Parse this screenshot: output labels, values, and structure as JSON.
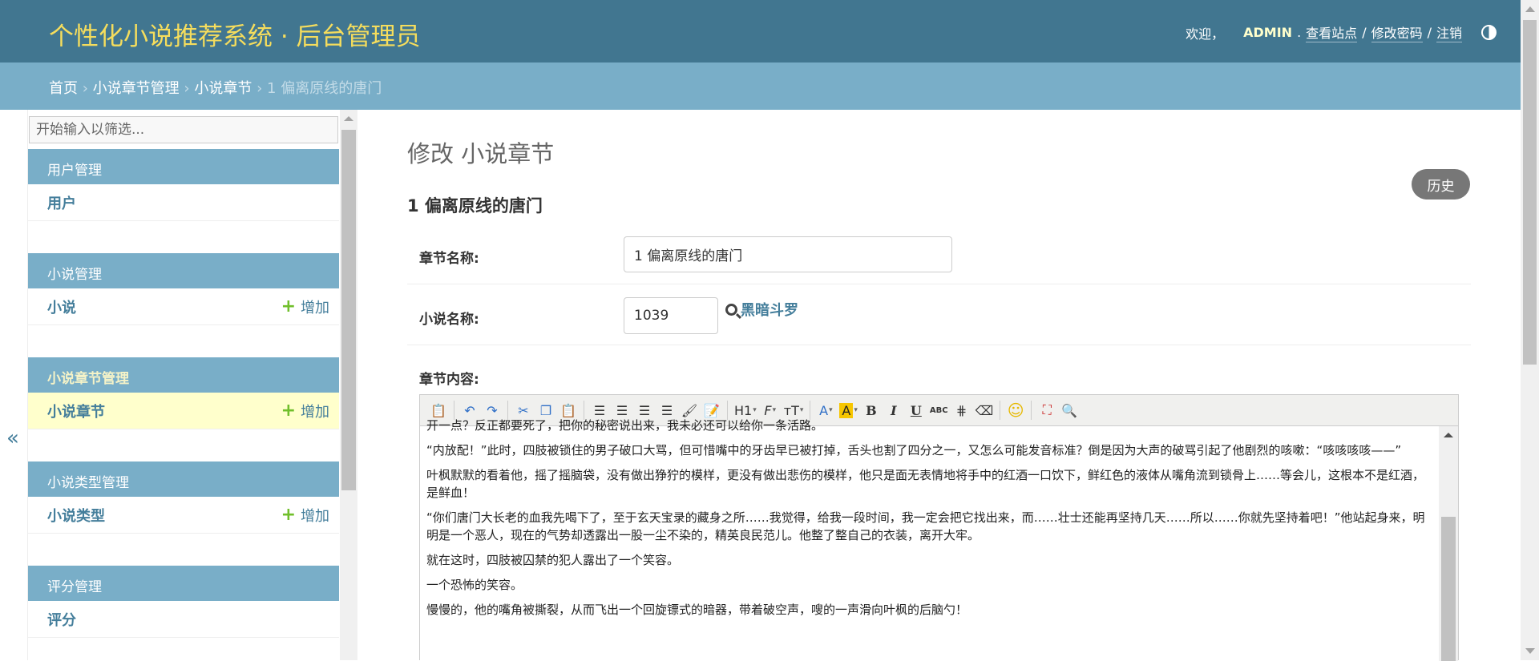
{
  "header": {
    "site_title": "个性化小说推荐系统 · 后台管理员",
    "welcome": "欢迎，",
    "username": "ADMIN",
    "view_site": "查看站点",
    "change_password": "修改密码",
    "logout": "注销",
    "sep": "/"
  },
  "breadcrumbs": {
    "home": "首页",
    "app": "小说章节管理",
    "model": "小说章节",
    "current": "1 偏离原线的唐门",
    "sep": "›"
  },
  "sidebar": {
    "toggle": "«",
    "filter_placeholder": "开始输入以筛选...",
    "add_label": "增加",
    "modules": [
      {
        "title": "用户管理",
        "model": "用户",
        "has_add": false
      },
      {
        "title": "小说管理",
        "model": "小说",
        "has_add": true
      },
      {
        "title": "小说章节管理",
        "model": "小说章节",
        "has_add": true,
        "current": true
      },
      {
        "title": "小说类型管理",
        "model": "小说类型",
        "has_add": true
      },
      {
        "title": "评分管理",
        "model": "评分",
        "has_add": false
      }
    ]
  },
  "content": {
    "title": "修改 小说章节",
    "history": "历史",
    "object_title": "1 偏离原线的唐门",
    "fields": {
      "chapter_name_label": "章节名称:",
      "chapter_name_value": "1 偏离原线的唐门",
      "novel_label": "小说名称:",
      "novel_value": "1039",
      "novel_lookup": "黑暗斗罗",
      "content_label": "章节内容:"
    },
    "editor": {
      "paragraphs": [
        "开一点？反正都要死了，把你的秘密说出来，我未必还可以给你一条活路。",
        "“内放配！”此时，四肢被锁住的男子破口大骂，但可惜嘴中的牙齿早已被打掉，舌头也割了四分之一，又怎么可能发音标准？倒是因为大声的破骂引起了他剧烈的咳嗽：“咳咳咳咳——”",
        "叶枫默默的看着他，摇了摇脑袋，没有做出狰狞的模样，更没有做出悲伤的模样，他只是面无表情地将手中的红酒一口饮下，鲜红色的液体从嘴角流到锁骨上……等会儿，这根本不是红酒，是鲜血！",
        "“你们唐门大长老的血我先喝下了，至于玄天宝录的藏身之所……我觉得，给我一段时间，我一定会把它找出来，而……壮士还能再坚持几天……所以……你就先坚持着吧！”他站起身来，明明是一个恶人，现在的气势却透露出一股一尘不染的，精英良民范儿。他整了整自己的衣装，离开大牢。",
        "就在这时，四肢被囚禁的犯人露出了一个笑容。",
        "一个恐怖的笑容。",
        "慢慢的，他的嘴角被撕裂，从而飞出一个回旋镖式的暗器，带着破空声，嗖的一声滑向叶枫的后脑勺！"
      ],
      "toolbar": {
        "heading": "H1",
        "font": "F",
        "size": "тT",
        "font_color": "A",
        "bg_color": "A",
        "bold": "B",
        "italic": "I",
        "underline": "U",
        "strike": "ABC"
      }
    }
  },
  "colors": {
    "header": "#417690",
    "breadcrumb": "#79aec8",
    "title": "#f5dd5d",
    "link": "#447e9b",
    "add": "#70bf2b",
    "current_row": "#ffffcc"
  }
}
